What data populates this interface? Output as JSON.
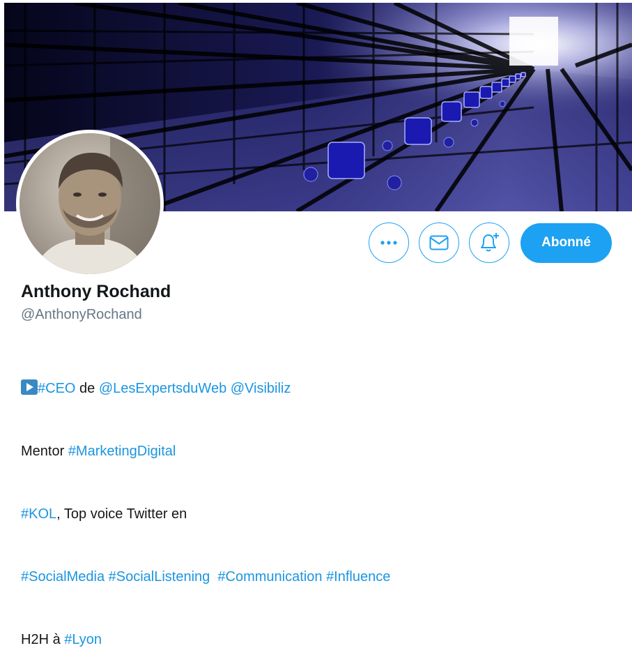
{
  "profile": {
    "name": "Anthony Rochand",
    "handle": "@AnthonyRochand"
  },
  "actions": {
    "more_icon": "more-dots-icon",
    "message_icon": "envelope-icon",
    "notify_icon": "bell-plus-icon",
    "follow_label": "Abonné"
  },
  "bio": {
    "line1": [
      {
        "text": "#CEO",
        "link": true
      },
      {
        "text": " de ",
        "link": false
      },
      {
        "text": "@LesExpertsduWeb",
        "link": true
      },
      {
        "text": " ",
        "link": false
      },
      {
        "text": "@Visibiliz",
        "link": true
      }
    ],
    "line2": [
      {
        "text": "Mentor ",
        "link": false
      },
      {
        "text": "#MarketingDigital",
        "link": true
      }
    ],
    "line3": [
      {
        "text": "#KOL",
        "link": true
      },
      {
        "text": ", Top voice Twitter en",
        "link": false
      }
    ],
    "line4": [
      {
        "text": "#SocialMedia",
        "link": true
      },
      {
        "text": " ",
        "link": false
      },
      {
        "text": "#SocialListening",
        "link": true
      },
      {
        "text": "  ",
        "link": false
      },
      {
        "text": "#Communication",
        "link": true
      },
      {
        "text": " ",
        "link": false
      },
      {
        "text": "#Influence",
        "link": true
      }
    ],
    "line5": [
      {
        "text": "H2H à ",
        "link": false
      },
      {
        "text": "#Lyon",
        "link": true
      }
    ]
  },
  "colors": {
    "accent": "#1da1f2",
    "link": "#1b95e0",
    "text": "#14171a",
    "muted": "#657786"
  }
}
